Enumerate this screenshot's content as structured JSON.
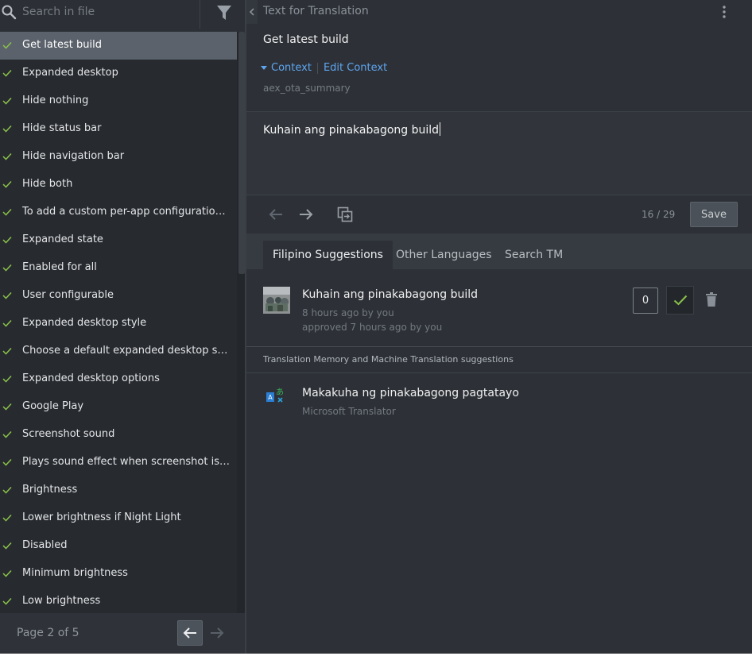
{
  "sidebar": {
    "search_placeholder": "Search in file",
    "entities": [
      "Get latest build",
      "Expanded desktop",
      "Hide nothing",
      "Hide status bar",
      "Hide navigation bar",
      "Hide both",
      "To add a custom per-app configuration f...",
      "Expanded state",
      "Enabled for all",
      "User configurable",
      "Expanded desktop style",
      "Choose a default expanded desktop style",
      "Expanded desktop options",
      "Google Play",
      "Screenshot sound",
      "Plays sound effect when screenshot is ta...",
      "Brightness",
      "Lower brightness if Night Light",
      "Disabled",
      "Minimum brightness",
      "Low brightness"
    ],
    "selected_index": 0,
    "page_label": "Page 2 of 5"
  },
  "main": {
    "source_header": "Text for Translation",
    "source_text": "Get latest build",
    "context_label": "Context",
    "edit_context_label": "Edit Context",
    "context_key": "aex_ota_summary",
    "translation": "Kuhain ang pinakabagong build",
    "counter": "16 / 29",
    "save_label": "Save"
  },
  "tabs": [
    {
      "label": "Filipino Suggestions",
      "active": true
    },
    {
      "label": "Other Languages",
      "active": false
    },
    {
      "label": "Search TM",
      "active": false
    }
  ],
  "suggestion": {
    "text": "Kuhain ang pinakabagong build",
    "meta1": "8 hours ago by you",
    "meta2": "approved 7 hours ago by you",
    "votes": "0"
  },
  "tm_header": "Translation Memory and Machine Translation suggestions",
  "mt": {
    "text": "Makakuha ng pinakabagong pagtatayo",
    "source": "Microsoft Translator"
  },
  "colors": {
    "accent": "#5ea5ef",
    "check": "#8bc34a",
    "sidebar_bg": "#272a2f",
    "main_bg": "#2d3137",
    "selected": "#5b626b"
  }
}
